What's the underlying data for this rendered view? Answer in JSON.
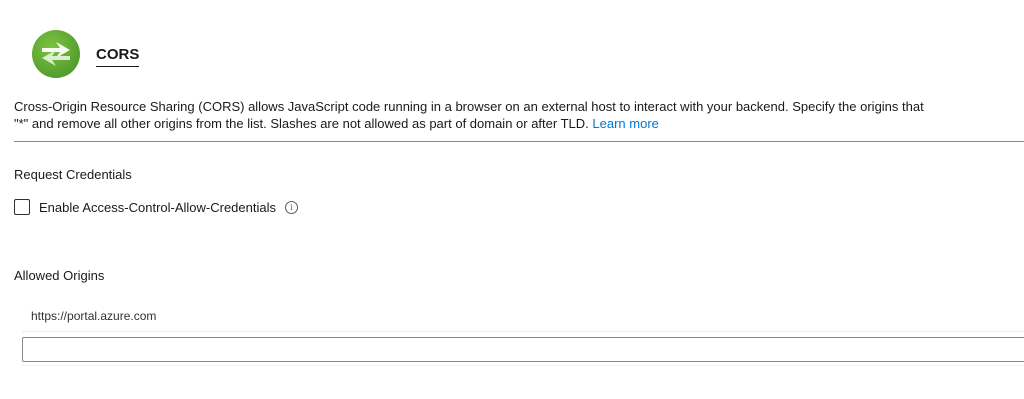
{
  "header": {
    "title": "CORS",
    "logo_icon": "azure-app-service-cors-icon"
  },
  "description": {
    "line1": "Cross-Origin Resource Sharing (CORS) allows JavaScript code running in a browser on an external host to interact with your backend. Specify the origins that",
    "line2": "\"*\" and remove all other origins from the list. Slashes are not allowed as part of domain or after TLD.",
    "learn_more": "Learn more"
  },
  "credentials": {
    "section_label": "Request Credentials",
    "checkbox_label": "Enable Access-Control-Allow-Credentials",
    "checked": false,
    "info_icon": "info-icon"
  },
  "origins": {
    "section_label": "Allowed Origins",
    "items": [
      "https://portal.azure.com"
    ],
    "new_origin_value": "",
    "new_origin_placeholder": ""
  },
  "colors": {
    "link": "#0078d4",
    "text": "#1b1a19",
    "logo_green": "#5ea832"
  }
}
